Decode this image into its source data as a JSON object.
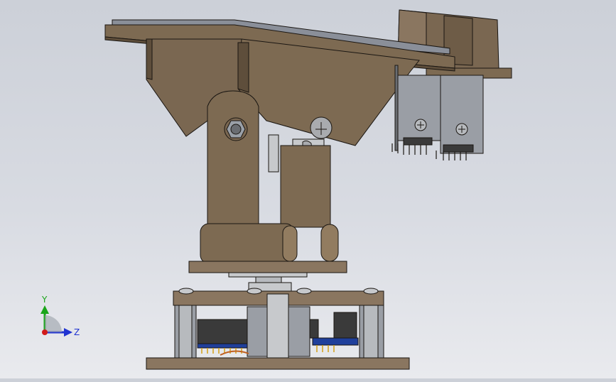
{
  "viewport": {
    "background_top": "#ccd0d8",
    "background_bottom": "#e9eaee"
  },
  "colors": {
    "bracket": "#7d6a52",
    "bracket_dark": "#5e4e3b",
    "bracket_light": "#927c60",
    "outline": "#1a1612",
    "panel_top": "#8a8f99",
    "servo_body": "#9a9ea5",
    "pcb_blue": "#1f3f9b",
    "steel": "#c7c9cc",
    "axis_y": "#1aa51a",
    "axis_z": "#2033d1",
    "axis_origin": "#d11a1a"
  },
  "triad": {
    "y_label": "Y",
    "z_label": "Z"
  }
}
